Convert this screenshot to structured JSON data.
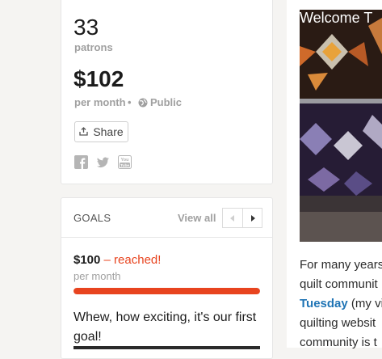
{
  "stats": {
    "patron_count": "33",
    "patron_label": "patrons",
    "amount": "$102",
    "period": "per month",
    "separator": "•",
    "visibility": "Public",
    "share_label": "Share"
  },
  "social": [
    {
      "name": "facebook-icon"
    },
    {
      "name": "twitter-icon"
    },
    {
      "name": "youtube-icon"
    }
  ],
  "goals": {
    "title": "GOALS",
    "view_all": "View all",
    "goal_amount": "$100",
    "goal_status": "– reached!",
    "goal_period": "per month",
    "progress_percent": 100,
    "description": "Whew, how exciting, it's our first goal!"
  },
  "video": {
    "title": "Welcome T"
  },
  "about": {
    "line1": "For many years",
    "line2": "quilt communit",
    "link": "Tuesday",
    "line3_rest": " (my vi",
    "line4": "quilting websit",
    "line5": "community is t"
  },
  "colors": {
    "accent": "#e8441f",
    "link": "#1f74b5",
    "muted": "#a0a0a0"
  }
}
